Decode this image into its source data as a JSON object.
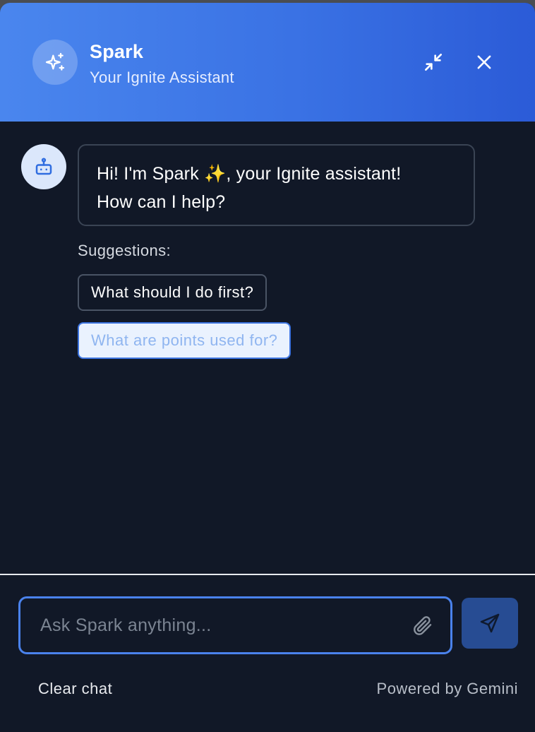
{
  "header": {
    "title": "Spark",
    "subtitle": "Your Ignite Assistant",
    "avatar_icon": "sparkles-icon",
    "minimize_icon": "minimize-icon",
    "close_icon": "close-icon"
  },
  "messages": [
    {
      "sender": "bot",
      "avatar_icon": "robot-icon",
      "lines": [
        "Hi! I'm Spark ✨, your Ignite assistant!",
        "How can I help?"
      ]
    }
  ],
  "suggestions": {
    "label": "Suggestions:",
    "items": [
      "What should I do first?",
      "What are points used for?"
    ]
  },
  "composer": {
    "placeholder": "Ask Spark anything...",
    "value": "",
    "attach_icon": "paperclip-icon",
    "send_icon": "send-icon"
  },
  "footer": {
    "clear_label": "Clear chat",
    "powered_label": "Powered by Gemini"
  },
  "colors": {
    "header_gradient_start": "#4a86ee",
    "header_gradient_end": "#2b5bd7",
    "panel_background": "#111827",
    "accent": "#4a82ec",
    "send_button": "#274c93"
  }
}
